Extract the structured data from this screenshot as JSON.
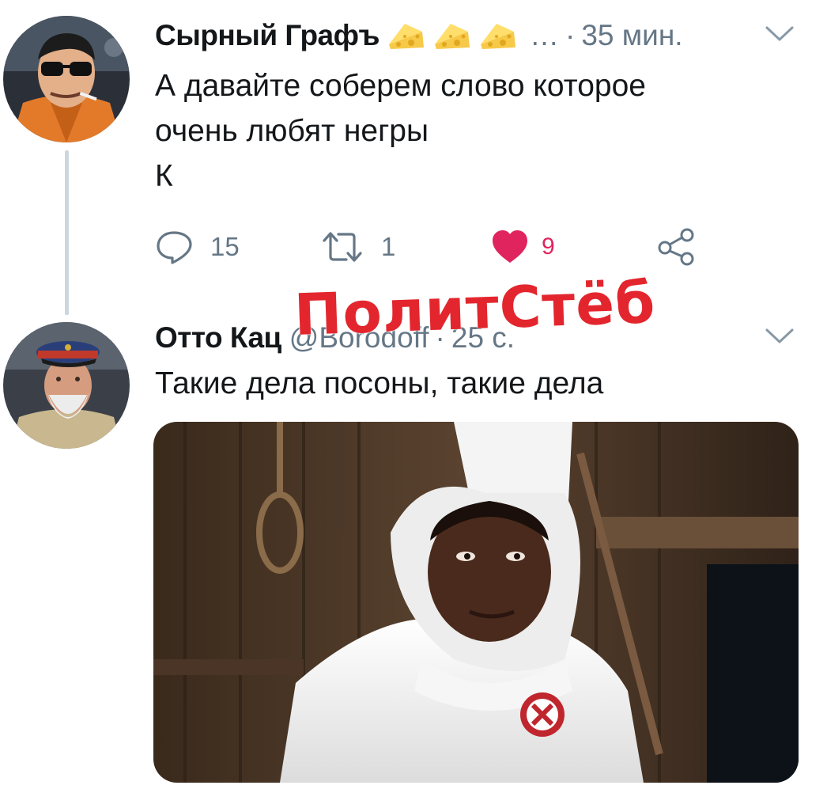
{
  "tweets": [
    {
      "name": "Сырный Графъ",
      "badge_icon": "cheese-emoji",
      "badge_count": 3,
      "overflow": "…",
      "separator": "·",
      "time": "35 мин.",
      "text": "А давайте соберем слово которое\nочень любят негры\nК",
      "replies": "15",
      "retweets": "1",
      "likes": "9"
    },
    {
      "name": "Отто Кац",
      "handle": "@Borodoff",
      "separator": "·",
      "time": "25 с.",
      "text": "Такие дела посоны, такие дела"
    }
  ],
  "watermark": "ПолитСтёб",
  "colors": {
    "text": "#14171a",
    "muted": "#657786",
    "like": "#e0245e",
    "watermark": "#e3262e",
    "thread_line": "#ccd6dd"
  }
}
